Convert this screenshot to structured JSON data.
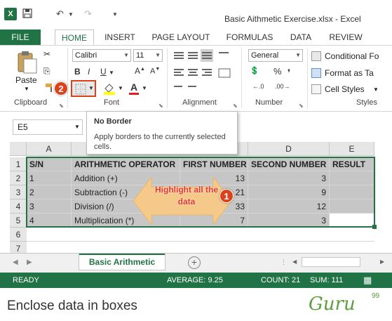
{
  "window": {
    "title": "Basic Aithmetic Exercise.xlsx - Excel",
    "app_icon": "X"
  },
  "tabs": [
    "FILE",
    "HOME",
    "INSERT",
    "PAGE LAYOUT",
    "FORMULAS",
    "DATA",
    "REVIEW"
  ],
  "ribbon": {
    "paste_label": "Paste",
    "font_name": "Calibri",
    "font_size": "11",
    "number_format": "General",
    "conditional_formatting": "Conditional Fo",
    "format_as_table": "Format as Ta",
    "cell_styles": "Cell Styles",
    "groups": [
      "Clipboard",
      "Font",
      "Alignment",
      "Number",
      "Styles"
    ]
  },
  "formula_bar": {
    "name_box": "E5"
  },
  "tooltip": {
    "title": "No Border",
    "body": "Apply borders to the currently selected cells."
  },
  "columns": [
    "A",
    "B",
    "C",
    "D",
    "E"
  ],
  "rows": [
    "1",
    "2",
    "3",
    "4",
    "5",
    "6",
    "7"
  ],
  "table": [
    [
      "S/N",
      "ARITHMETIC OPERATOR",
      "FIRST NUMBER",
      "SECOND NUMBER",
      "RESULT"
    ],
    [
      "1",
      "Addition (+)",
      "13",
      "3",
      ""
    ],
    [
      "2",
      "Subtraction (-)",
      "21",
      "9",
      ""
    ],
    [
      "3",
      "Division (/)",
      "33",
      "12",
      ""
    ],
    [
      "4",
      "Multiplication (*)",
      "7",
      "3",
      ""
    ]
  ],
  "sheet_tab": "Basic Arithmetic",
  "status": {
    "ready": "READY",
    "average": "AVERAGE: 9.25",
    "count": "COUNT: 21",
    "sum": "SUM: 111"
  },
  "annotation": {
    "callout": "Highlight all the data",
    "step1": "1",
    "step2": "2"
  },
  "caption": "Enclose data in boxes",
  "logo": {
    "text": "Guru",
    "sup": "99"
  },
  "colors": {
    "excel_green": "#217346",
    "selection": "#c6c6c6",
    "callout_arrow": "#f4c98a",
    "badge": "#d9421a"
  }
}
